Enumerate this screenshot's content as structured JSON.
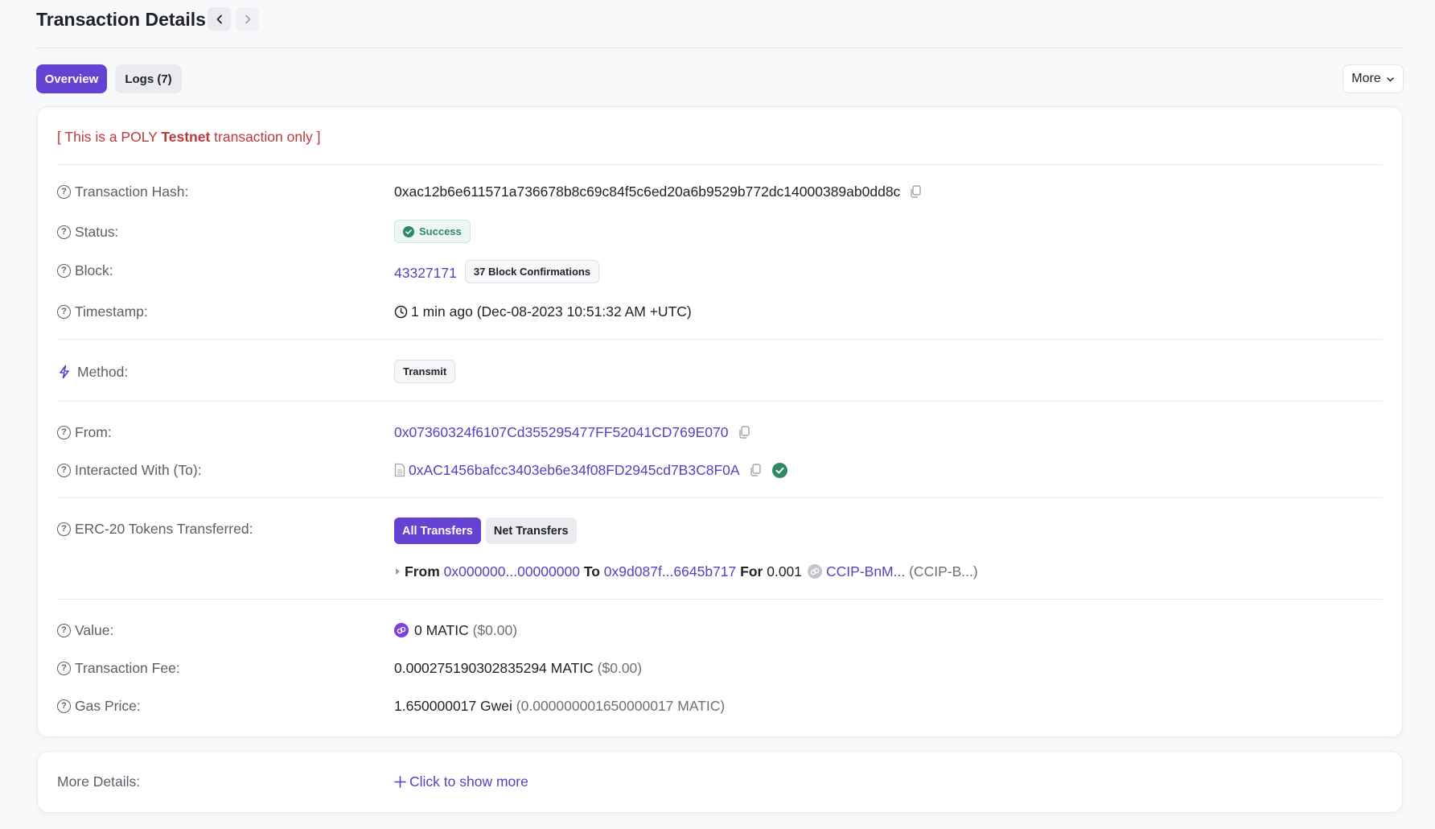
{
  "header": {
    "title": "Transaction Details",
    "prev_icon": "chevron-left-icon",
    "next_icon": "chevron-right-icon"
  },
  "tabs": [
    {
      "label": "Overview",
      "active": true
    },
    {
      "label": "Logs (7)",
      "active": false
    }
  ],
  "more_button": {
    "label": "More",
    "icon": "chevron-down-icon"
  },
  "notice": {
    "prefix": "[ This is a POLY ",
    "bold": "Testnet",
    "suffix": " transaction only ]"
  },
  "rows": {
    "tx_hash": {
      "label": "Transaction Hash:",
      "value": "0xac12b6e611571a736678b8c69c84f5c6ed20a6b9529b772dc14000389ab0dd8c"
    },
    "status": {
      "label": "Status:",
      "value": "Success"
    },
    "block": {
      "label": "Block:",
      "value": "43327171",
      "confirmations": "37 Block Confirmations"
    },
    "timestamp": {
      "label": "Timestamp:",
      "value": "1 min ago (Dec-08-2023 10:51:32 AM +UTC)"
    },
    "method": {
      "label": "Method:",
      "value": "Transmit"
    },
    "from": {
      "label": "From:",
      "value": "0x07360324f6107Cd355295477FF52041CD769E070"
    },
    "to": {
      "label": "Interacted With (To):",
      "value": "0xAC1456bafcc3403eb6e34f08FD2945cd7B3C8F0A"
    },
    "erc20": {
      "label": "ERC-20 Tokens Transferred:",
      "filters": [
        "All Transfers",
        "Net Transfers"
      ],
      "transfer": {
        "from_label": "From",
        "from_address": "0x000000...00000000",
        "to_label": "To",
        "to_address": "0x9d087f...6645b717",
        "for_label": "For",
        "amount": "0.001",
        "token_name": "CCIP-BnM...",
        "token_symbol": "(CCIP-B...)"
      }
    },
    "value": {
      "label": "Value:",
      "amount": "0 MATIC",
      "usd": "($0.00)"
    },
    "fee": {
      "label": "Transaction Fee:",
      "amount": "0.000275190302835294 MATIC",
      "usd": "($0.00)"
    },
    "gas_price": {
      "label": "Gas Price:",
      "amount": "1.650000017 Gwei",
      "native": "(0.000000001650000017 MATIC)"
    }
  },
  "more_details": {
    "label": "More Details:",
    "action": "Click to show more"
  },
  "colors": {
    "accent": "#6542d1",
    "link": "#5a3fc0",
    "success": "#2e8a66",
    "warning_text": "#c0373a"
  }
}
